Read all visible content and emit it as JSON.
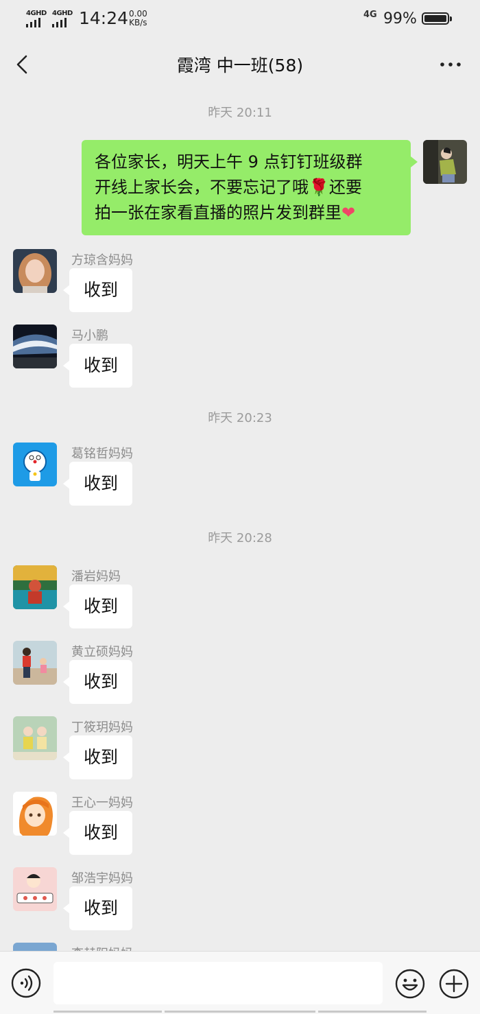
{
  "status_bar": {
    "network_left_1": "4GHD",
    "network_left_2": "4GHD",
    "time": "14:24",
    "speed_value": "0.00",
    "speed_unit": "KB/s",
    "network_right": "4G",
    "battery": "99%"
  },
  "header": {
    "title": "霞湾 中一班(58)",
    "back_icon": "chevron-left-icon",
    "more_icon": "more-horizontal-icon"
  },
  "timestamps": [
    "昨天 20:11",
    "昨天 20:23",
    "昨天 20:28"
  ],
  "sent_message": {
    "line1": "各位家长，明天上午 9 点钉钉班级群",
    "line2_a": "开线上家长会，不要忘记了哦",
    "rose": "🌹",
    "line2_b": "还要",
    "line3": "拍一张在家看直播的照片发到群里",
    "heart": "❤"
  },
  "messages": [
    {
      "name": "方琼含妈妈",
      "text": "收到",
      "avatar_color": "#b07a5a"
    },
    {
      "name": "马小鹏",
      "text": "收到",
      "avatar_color": "#3b4e6b"
    },
    {
      "name": "葛铭哲妈妈",
      "text": "收到",
      "avatar_color": "#1e9be6"
    },
    {
      "name": "潘岩妈妈",
      "text": "收到",
      "avatar_color": "#2f6f3e"
    },
    {
      "name": "黄立硕妈妈",
      "text": "收到",
      "avatar_color": "#a9c3c9"
    },
    {
      "name": "丁筱玥妈妈",
      "text": "收到",
      "avatar_color": "#9ebf9a"
    },
    {
      "name": "王心一妈妈",
      "text": "收到",
      "avatar_color": "#f2a24a"
    },
    {
      "name": "邹浩宇妈妈",
      "text": "收到",
      "avatar_color": "#f6d2d0"
    },
    {
      "name": "李赫阳妈妈",
      "text": "",
      "avatar_color": "#7aa6d1"
    }
  ],
  "input_bar": {
    "voice_icon": "voice-icon",
    "emoji_icon": "emoji-icon",
    "plus_icon": "plus-icon",
    "input_value": ""
  }
}
